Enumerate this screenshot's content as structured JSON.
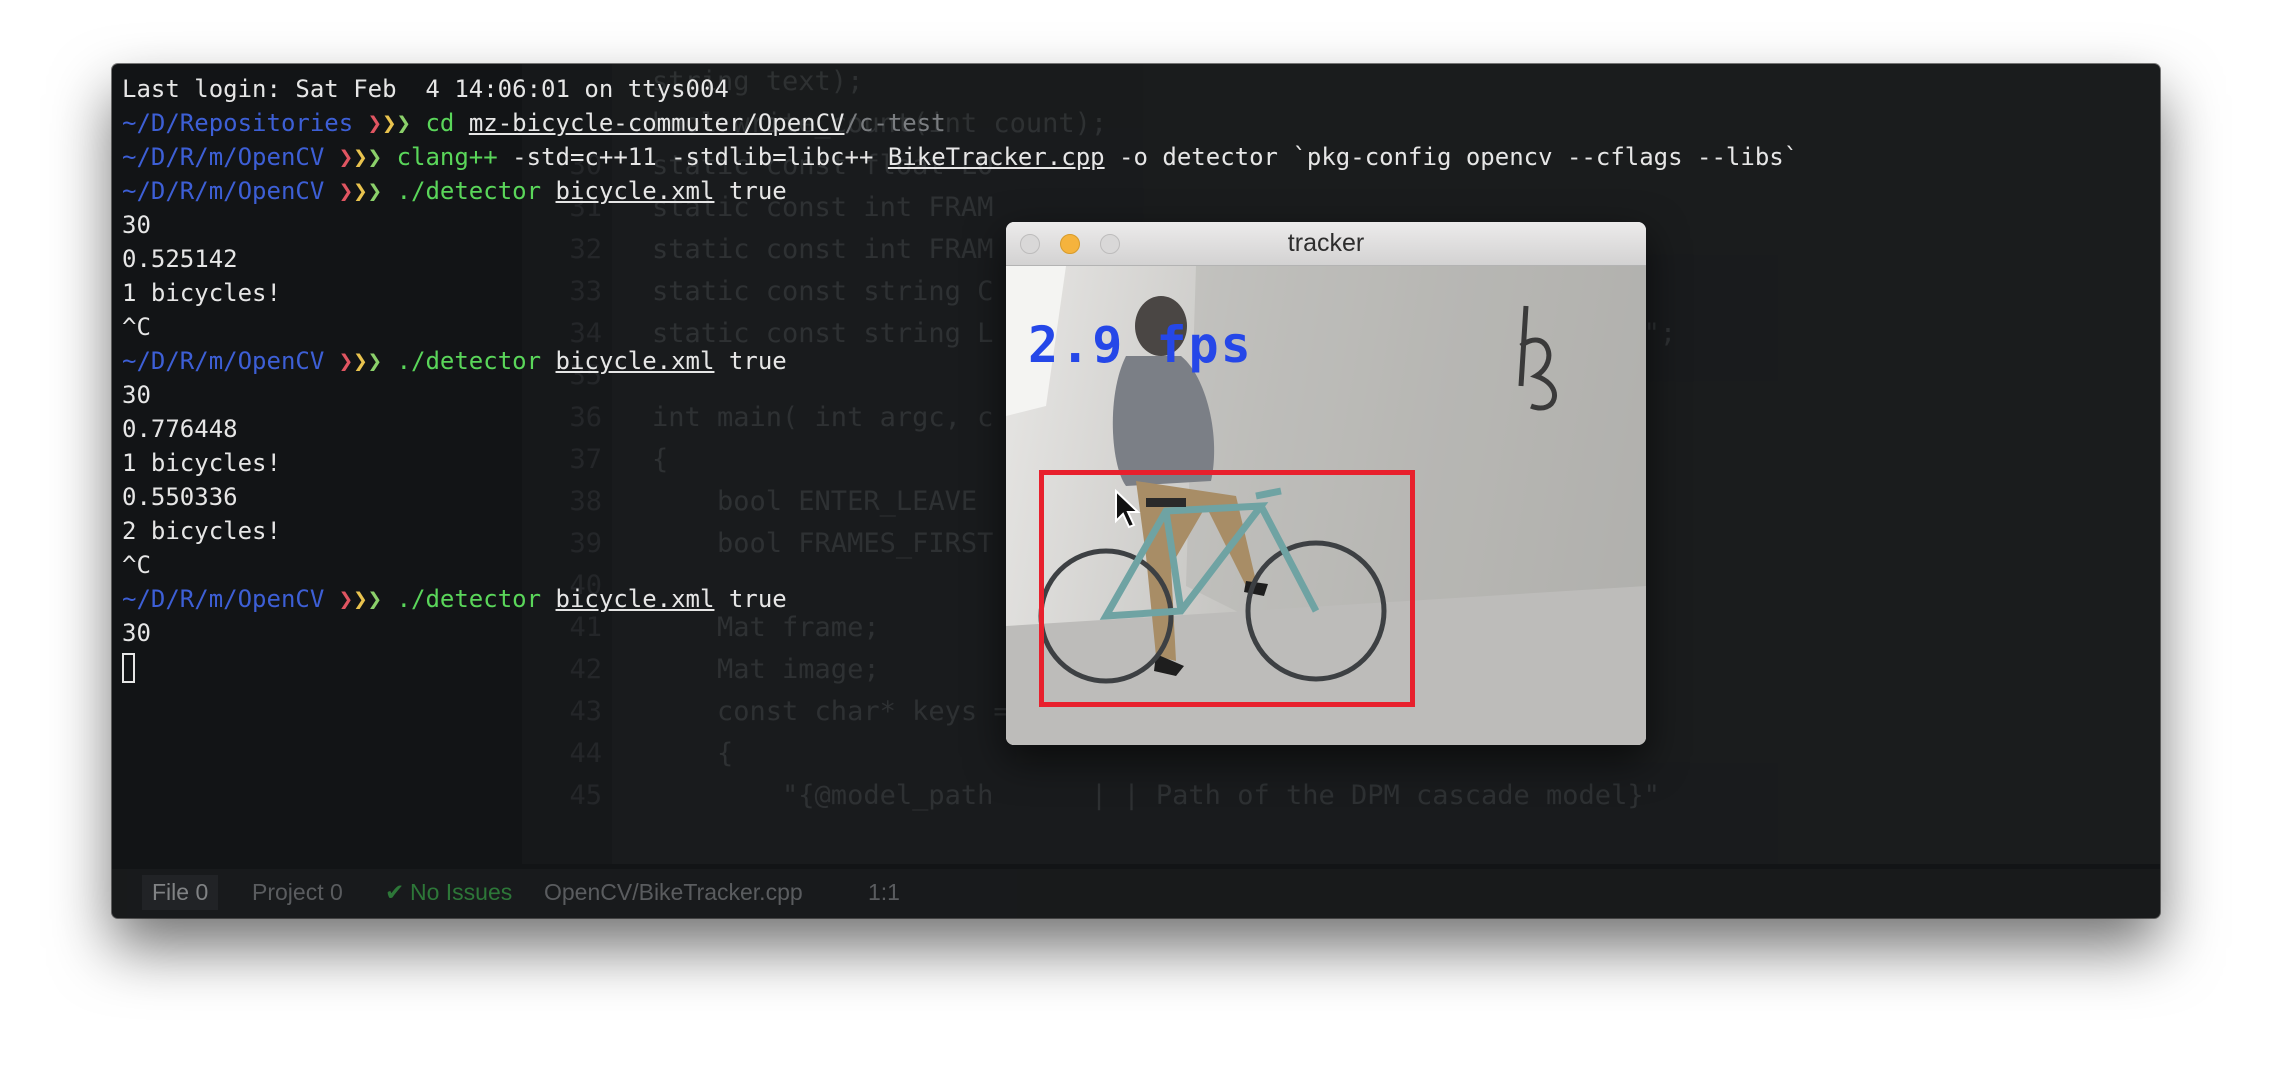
{
  "terminal": {
    "lines": [
      {
        "kind": "text",
        "text": "Last login: Sat Feb  4 14:06:01 on ttys004"
      },
      {
        "kind": "prompt",
        "path": "~/D/Repositories",
        "cmd": "cd",
        "arg_u": "mz-bicycle-commuter/OpenCV",
        "arg_rest": "/c-test"
      },
      {
        "kind": "prompt",
        "path": "~/D/R/m/OpenCV",
        "cmd": "clang++",
        "pre": " -std=c++11 -stdlib=libc++ ",
        "arg_u": "BikeTracker.cpp",
        "arg_rest": " -o detector `pkg-config opencv --cflags --libs`"
      },
      {
        "kind": "prompt",
        "path": "~/D/R/m/OpenCV",
        "cmd": "./detector",
        "arg_u": "bicycle.xml",
        "arg_rest": " true"
      },
      {
        "kind": "text",
        "text": "30"
      },
      {
        "kind": "text",
        "text": "0.525142"
      },
      {
        "kind": "text",
        "text": "1 bicycles!"
      },
      {
        "kind": "text",
        "text": "^C"
      },
      {
        "kind": "prompt",
        "path": "~/D/R/m/OpenCV",
        "cmd": "./detector",
        "arg_u": "bicycle.xml",
        "arg_rest": " true"
      },
      {
        "kind": "text",
        "text": "30"
      },
      {
        "kind": "text",
        "text": "0.776448"
      },
      {
        "kind": "text",
        "text": "1 bicycles!"
      },
      {
        "kind": "text",
        "text": "0.550336"
      },
      {
        "kind": "text",
        "text": "2 bicycles!"
      },
      {
        "kind": "text",
        "text": "^C"
      },
      {
        "kind": "prompt",
        "path": "~/D/R/m/OpenCV",
        "cmd": "./detector",
        "arg_u": "bicycle.xml",
        "arg_rest": " true"
      },
      {
        "kind": "text",
        "text": "30"
      },
      {
        "kind": "cursor",
        "text": ""
      }
    ],
    "prompt_arrows": "❯❯❯"
  },
  "editor_ghost": {
    "lines": [
      {
        "ln": "",
        "code": "string text);"
      },
      {
        "ln": "",
        "code": "bool write_count(int count);"
      },
      {
        "ln": "30",
        "code": "static const float LO"
      },
      {
        "ln": "31",
        "code": "static const int FRAM"
      },
      {
        "ln": "32",
        "code": "static const int FRAM"
      },
      {
        "ln": "33",
        "code": "static const string C                        reset\";"
      },
      {
        "ln": "34",
        "code": "static const string L                        muter/left.count\";"
      },
      {
        "ln": "35",
        "code": ""
      },
      {
        "ln": "36",
        "code": "int main( int argc, c"
      },
      {
        "ln": "37",
        "code": "{"
      },
      {
        "ln": "38",
        "code": "    bool ENTER_LEAVE"
      },
      {
        "ln": "39",
        "code": "    bool FRAMES_FIRST"
      },
      {
        "ln": "40",
        "code": ""
      },
      {
        "ln": "41",
        "code": "    Mat frame;"
      },
      {
        "ln": "42",
        "code": "    Mat image;"
      },
      {
        "ln": "43",
        "code": "    const char* keys ="
      },
      {
        "ln": "44",
        "code": "    {"
      },
      {
        "ln": "45",
        "code": "        \"{@model_path      | | Path of the DPM cascade model}\""
      }
    ]
  },
  "statusbar": {
    "file_tab": "File 0",
    "project_tab": "Project 0",
    "issues_icon": "check-icon",
    "issues": "No Issues",
    "filepath": "OpenCV/BikeTracker.cpp",
    "position": "1:1"
  },
  "tracker": {
    "title": "tracker",
    "fps_text": "2.9 fps",
    "box_color": "#e8202d",
    "fps_color": "#2547e8"
  },
  "colors": {
    "terminal_bg": "#121416",
    "prompt_path": "#3d5fd6",
    "command": "#5ad65a"
  }
}
